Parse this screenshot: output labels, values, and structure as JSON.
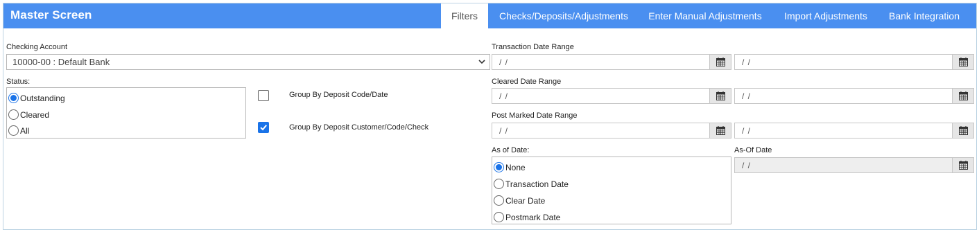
{
  "header": {
    "title": "Master Screen",
    "tabs": [
      {
        "label": "Filters",
        "active": true
      },
      {
        "label": "Checks/Deposits/Adjustments",
        "active": false
      },
      {
        "label": "Enter Manual Adjustments",
        "active": false
      },
      {
        "label": "Import Adjustments",
        "active": false
      },
      {
        "label": "Bank Integration",
        "active": false
      }
    ]
  },
  "colors": {
    "header_bg": "#4a8ff0",
    "accent": "#1a73e8"
  },
  "filters": {
    "checking_account": {
      "label": "Checking Account",
      "value": "10000-00 : Default Bank",
      "icon": "chevron-down-icon"
    },
    "status": {
      "label": "Status:",
      "options": [
        "Outstanding",
        "Cleared",
        "All"
      ],
      "selected": "Outstanding"
    },
    "group_by_deposit_code_date": {
      "label": "Group By Deposit Code/Date",
      "checked": false
    },
    "group_by_deposit_customer": {
      "label": "Group By Deposit Customer/Code/Check",
      "checked": true
    },
    "transaction_date_range": {
      "label": "Transaction Date Range",
      "from": " /  / ",
      "to": " /  / "
    },
    "cleared_date_range": {
      "label": "Cleared Date Range",
      "from": " /  / ",
      "to": " /  / "
    },
    "post_marked_date_range": {
      "label": "Post Marked Date Range",
      "from": " /  / ",
      "to": " /  / "
    },
    "as_of_date": {
      "label": "As of Date:",
      "options": [
        "None",
        "Transaction Date",
        "Clear Date",
        "Postmark Date"
      ],
      "selected": "None"
    },
    "as_of_date_value": {
      "label": "As-Of Date",
      "value": " /  / ",
      "disabled": true
    },
    "calendar_icon": "calendar-icon"
  }
}
